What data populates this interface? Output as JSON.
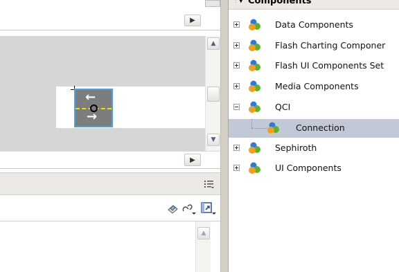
{
  "components_panel": {
    "title": "Components",
    "items": [
      {
        "label": "Data Components",
        "expanded": false
      },
      {
        "label": "Flash Charting Componer",
        "expanded": false
      },
      {
        "label": "Flash UI Components Set",
        "expanded": false
      },
      {
        "label": "Media Components",
        "expanded": false
      },
      {
        "label": "QCI",
        "expanded": true,
        "children": [
          {
            "label": "Connection",
            "selected": true
          }
        ]
      },
      {
        "label": "Sephiroth",
        "expanded": false
      },
      {
        "label": "UI Components",
        "expanded": false
      }
    ]
  },
  "stage": {
    "background": "#d6d6d6",
    "selected_symbol": "connection-component-instance"
  },
  "lower_panel": {
    "icons": [
      "eraser-icon",
      "link-icon",
      "edit-symbol-icon",
      "panel-menu-icon"
    ]
  },
  "colors": {
    "selection_row": "#c1c8d6",
    "stage_gray": "#d6d6d6",
    "symbol_fill": "#7d7d7d",
    "symbol_outline": "#4aa3e0",
    "dashed_line": "#f0e300"
  }
}
